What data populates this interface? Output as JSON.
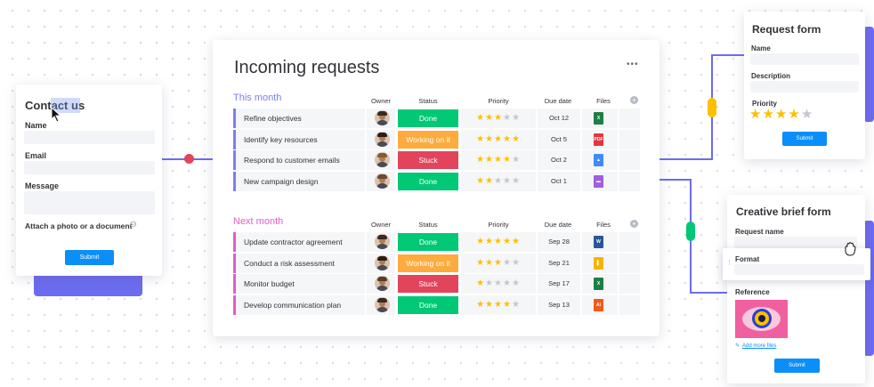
{
  "contact_form": {
    "title": "Contact us",
    "name_label": "Name",
    "email_label": "Email",
    "message_label": "Message",
    "attach_label": "Attach a photo or a document",
    "submit_label": "Submit"
  },
  "board": {
    "title": "Incoming requests",
    "menu_label": "•••",
    "columns": {
      "owner": "Owner",
      "status": "Status",
      "priority": "Priority",
      "due": "Due date",
      "files": "Files"
    },
    "groups": [
      {
        "title": "This month",
        "color": "#7b7ff0",
        "rows": [
          {
            "name": "Refine objectives",
            "status": "Done",
            "status_color": "#00c875",
            "stars": 3,
            "due": "Oct 12",
            "file": "xls",
            "file_color": "#1d7f46",
            "file_text": "X"
          },
          {
            "name": "Identify key resources",
            "status": "Working on it",
            "status_color": "#fdab3d",
            "stars": 5,
            "due": "Oct 5",
            "file": "pdf",
            "file_color": "#e2373f",
            "file_text": "PDF"
          },
          {
            "name": "Respond to customer emails",
            "status": "Stuck",
            "status_color": "#e2445c",
            "stars": 4,
            "due": "Oct 2",
            "file": "drive",
            "file_color": "#3f8cf7",
            "file_text": "▲"
          },
          {
            "name": "New campaign design",
            "status": "Done",
            "status_color": "#00c875",
            "stars": 2,
            "due": "Oct 1",
            "file": "doc",
            "file_color": "#a25ddc",
            "file_text": "▬"
          }
        ]
      },
      {
        "title": "Next month",
        "color": "#e25cc6",
        "rows": [
          {
            "name": "Update contractor agreement",
            "status": "Done",
            "status_color": "#00c875",
            "stars": 5,
            "due": "Sep 28",
            "file": "word",
            "file_color": "#2b579a",
            "file_text": "W"
          },
          {
            "name": "Conduct a risk assessment",
            "status": "Working on it",
            "status_color": "#fdab3d",
            "stars": 3,
            "due": "Sep 21",
            "file": "slides",
            "file_color": "#f4b400",
            "file_text": "▌"
          },
          {
            "name": "Monitor budget",
            "status": "Stuck",
            "status_color": "#e2445c",
            "stars": 1,
            "due": "Sep 17",
            "file": "xls",
            "file_color": "#1d7f46",
            "file_text": "X"
          },
          {
            "name": "Develop communication plan",
            "status": "Done",
            "status_color": "#00c875",
            "stars": 4,
            "due": "Sep 13",
            "file": "ai",
            "file_color": "#f25a19",
            "file_text": "Ai"
          }
        ]
      }
    ]
  },
  "request_form": {
    "title": "Request form",
    "name_label": "Name",
    "description_label": "Description",
    "priority_label": "Priority",
    "stars": 4,
    "submit_label": "Submit"
  },
  "creative_brief": {
    "title": "Creative brief form",
    "request_name_label": "Request name",
    "format_label": "Format",
    "reference_label": "Reference",
    "add_files_label": "Add more files",
    "submit_label": "Submit"
  },
  "colors": {
    "accent": "#6c6cf0",
    "button": "#0a8ef8",
    "connector_red": "#e2445c",
    "connector_yellow": "#fdbf00",
    "connector_green": "#00c875"
  }
}
